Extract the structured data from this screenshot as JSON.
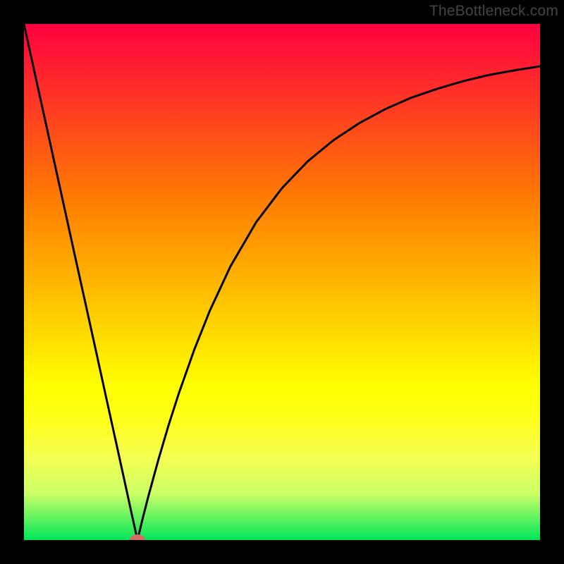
{
  "watermark": "TheBottleneck.com",
  "chart_data": {
    "type": "line",
    "title": "",
    "xlabel": "",
    "ylabel": "",
    "xlim": [
      0,
      100
    ],
    "ylim": [
      0,
      100
    ],
    "grid": false,
    "gradient_colors": {
      "top": "#ff0040",
      "mid": "#ffff00",
      "bottom": "#00e65a"
    },
    "x": [
      0,
      2,
      4,
      6,
      8,
      10,
      12,
      14,
      16,
      18,
      20,
      21,
      22,
      23,
      24,
      26,
      28,
      30,
      33,
      36,
      40,
      45,
      50,
      55,
      60,
      65,
      70,
      75,
      80,
      85,
      90,
      95,
      100
    ],
    "y": [
      100,
      90.9,
      81.8,
      72.7,
      63.6,
      54.5,
      45.5,
      36.4,
      27.3,
      18.2,
      9.1,
      4.5,
      0,
      4.2,
      8.1,
      15.4,
      22.2,
      28.4,
      36.9,
      44.4,
      53,
      61.6,
      68.2,
      73.4,
      77.5,
      80.8,
      83.5,
      85.7,
      87.4,
      88.9,
      90.1,
      91,
      91.8
    ],
    "marker": {
      "x": 22,
      "y": 0,
      "color": "#d96a6a"
    }
  }
}
